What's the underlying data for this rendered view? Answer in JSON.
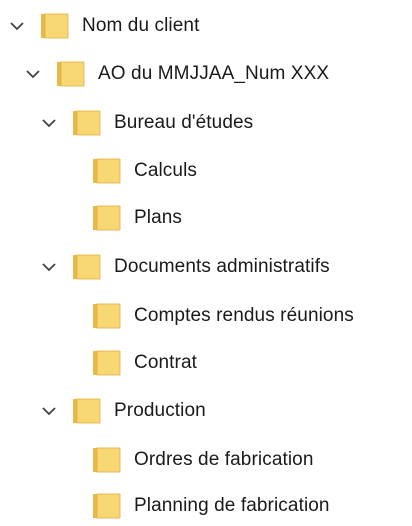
{
  "tree": {
    "items": [
      {
        "label": "Nom du client",
        "expanded": true
      },
      {
        "label": "AO du MMJJAA_Num XXX",
        "expanded": true
      },
      {
        "label": "Bureau d'études",
        "expanded": true
      },
      {
        "label": "Calculs",
        "expanded": false
      },
      {
        "label": "Plans",
        "expanded": false
      },
      {
        "label": "Documents administratifs",
        "expanded": true
      },
      {
        "label": "Comptes rendus réunions",
        "expanded": false
      },
      {
        "label": "Contrat",
        "expanded": false
      },
      {
        "label": "Production",
        "expanded": true
      },
      {
        "label": "Ordres de fabrication",
        "expanded": false
      },
      {
        "label": "Planning de fabrication",
        "expanded": false
      }
    ]
  },
  "colors": {
    "folder_body": "#F8D775",
    "folder_tab": "#E9B84A",
    "chevron": "#444444",
    "text": "#1a1a1a"
  },
  "icons": {
    "expand": "chevron-down-icon",
    "item": "folder-icon"
  }
}
